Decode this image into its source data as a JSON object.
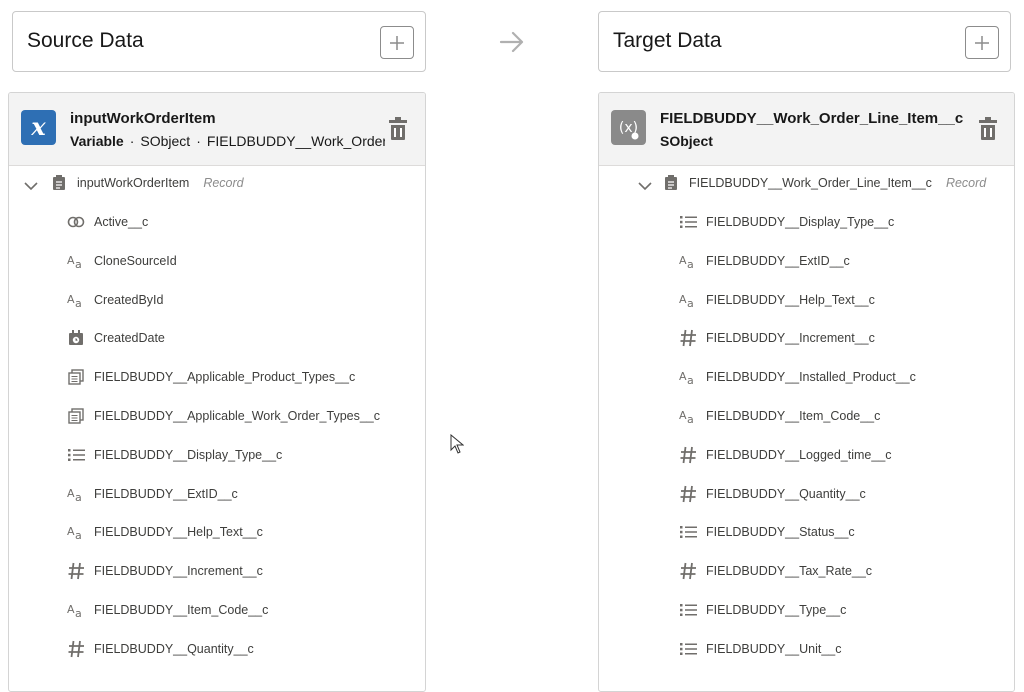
{
  "source": {
    "header_title": "Source Data",
    "variable_name": "inputWorkOrderItem",
    "variable_kind": "Variable",
    "variable_type": "SObject",
    "variable_object": "FIELDBUDDY__Work_Order_Item__c",
    "record_name": "inputWorkOrderItem",
    "record_tag": "Record",
    "fields": [
      {
        "icon": "link-icon",
        "label": "Active__c"
      },
      {
        "icon": "text-icon",
        "label": "CloneSourceId"
      },
      {
        "icon": "text-icon",
        "label": "CreatedById"
      },
      {
        "icon": "datetime-icon",
        "label": "CreatedDate"
      },
      {
        "icon": "multipicklist-icon",
        "label": "FIELDBUDDY__Applicable_Product_Types__c"
      },
      {
        "icon": "multipicklist-icon",
        "label": "FIELDBUDDY__Applicable_Work_Order_Types__c"
      },
      {
        "icon": "picklist-icon",
        "label": "FIELDBUDDY__Display_Type__c"
      },
      {
        "icon": "text-icon",
        "label": "FIELDBUDDY__ExtID__c"
      },
      {
        "icon": "text-icon",
        "label": "FIELDBUDDY__Help_Text__c"
      },
      {
        "icon": "number-icon",
        "label": "FIELDBUDDY__Increment__c"
      },
      {
        "icon": "text-icon",
        "label": "FIELDBUDDY__Item_Code__c"
      },
      {
        "icon": "number-icon",
        "label": "FIELDBUDDY__Quantity__c"
      }
    ]
  },
  "target": {
    "header_title": "Target Data",
    "variable_name": "FIELDBUDDY__Work_Order_Line_Item__c",
    "variable_type": "SObject",
    "record_name": "FIELDBUDDY__Work_Order_Line_Item__c",
    "record_tag": "Record",
    "fields": [
      {
        "icon": "picklist-icon",
        "label": "FIELDBUDDY__Display_Type__c"
      },
      {
        "icon": "text-icon",
        "label": "FIELDBUDDY__ExtID__c"
      },
      {
        "icon": "text-icon",
        "label": "FIELDBUDDY__Help_Text__c"
      },
      {
        "icon": "number-icon",
        "label": "FIELDBUDDY__Increment__c"
      },
      {
        "icon": "text-icon",
        "label": "FIELDBUDDY__Installed_Product__c"
      },
      {
        "icon": "text-icon",
        "label": "FIELDBUDDY__Item_Code__c"
      },
      {
        "icon": "number-icon",
        "label": "FIELDBUDDY__Logged_time__c"
      },
      {
        "icon": "number-icon",
        "label": "FIELDBUDDY__Quantity__c"
      },
      {
        "icon": "picklist-icon",
        "label": "FIELDBUDDY__Status__c"
      },
      {
        "icon": "number-icon",
        "label": "FIELDBUDDY__Tax_Rate__c"
      },
      {
        "icon": "picklist-icon",
        "label": "FIELDBUDDY__Type__c"
      },
      {
        "icon": "picklist-icon",
        "label": "FIELDBUDDY__Unit__c"
      }
    ]
  },
  "colors": {
    "source_variable_icon": "#2e6fb4",
    "target_variable_icon": "#8a8a8a"
  }
}
